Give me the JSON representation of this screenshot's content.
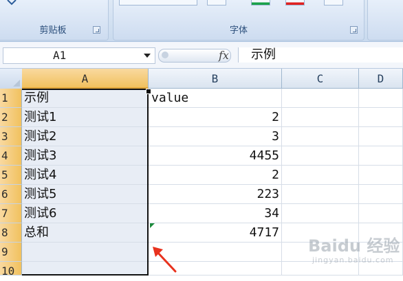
{
  "ribbon": {
    "clipboard_label": "剪贴板",
    "font_label": "字体"
  },
  "formula_bar": {
    "name_box": "A1",
    "fx_label": "fx",
    "formula": "示例"
  },
  "sheet": {
    "columns": [
      "A",
      "B",
      "C",
      "D"
    ],
    "rows": [
      "1",
      "2",
      "3",
      "4",
      "5",
      "6",
      "7",
      "8",
      "9",
      "10"
    ],
    "col_a": [
      "示例",
      "测试1",
      "测试2",
      "测试3",
      "测试4",
      "测试5",
      "测试6",
      "总和",
      "",
      ""
    ],
    "col_b": [
      "value",
      "2",
      "3",
      "4455",
      "2",
      "223",
      "34",
      "4717",
      "",
      ""
    ]
  },
  "watermark": {
    "main": "Baidu 经验",
    "sub": "jingyan.baidu.com"
  },
  "colors": {
    "selected_header": "#f1c15f",
    "ribbon": "#cddcf0",
    "arrow": "#e8321e"
  }
}
